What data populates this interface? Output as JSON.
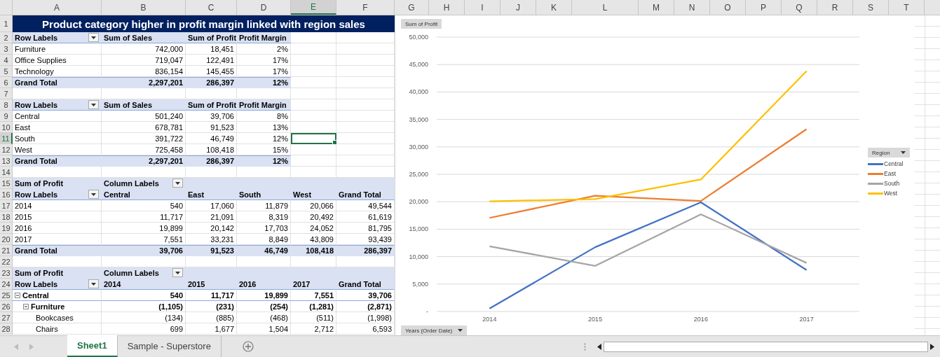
{
  "columns": [
    {
      "label": "A",
      "selected": false
    },
    {
      "label": "B",
      "selected": false
    },
    {
      "label": "C",
      "selected": false
    },
    {
      "label": "D",
      "selected": false
    },
    {
      "label": "E",
      "selected": true
    },
    {
      "label": "F",
      "selected": false
    },
    {
      "label": "G",
      "selected": false
    },
    {
      "label": "H",
      "selected": false
    },
    {
      "label": "I",
      "selected": false
    },
    {
      "label": "J",
      "selected": false
    },
    {
      "label": "K",
      "selected": false
    },
    {
      "label": "L",
      "selected": false
    },
    {
      "label": "M",
      "selected": false
    },
    {
      "label": "N",
      "selected": false
    },
    {
      "label": "O",
      "selected": false
    },
    {
      "label": "P",
      "selected": false
    },
    {
      "label": "Q",
      "selected": false
    },
    {
      "label": "R",
      "selected": false
    },
    {
      "label": "S",
      "selected": false
    },
    {
      "label": "T",
      "selected": false
    }
  ],
  "rows": [
    {
      "number": "1",
      "selected": false,
      "kind": "title",
      "title": "Product category higher in profit margin linked with region sales"
    },
    {
      "number": "2",
      "selected": false,
      "kind": "header",
      "cells": [
        {
          "text": "Row Labels",
          "filter": true
        },
        {
          "text": "Sum of Sales"
        },
        {
          "text": "Sum of Profit"
        },
        {
          "text": "Profit Margin"
        },
        null,
        null
      ]
    },
    {
      "number": "3",
      "selected": false,
      "kind": "data",
      "cells": [
        {
          "text": "Furniture"
        },
        {
          "text": "742,000"
        },
        {
          "text": "18,451"
        },
        {
          "text": "2%"
        },
        null,
        null
      ]
    },
    {
      "number": "4",
      "selected": false,
      "kind": "data",
      "cells": [
        {
          "text": "Office Supplies"
        },
        {
          "text": "719,047"
        },
        {
          "text": "122,491"
        },
        {
          "text": "17%"
        },
        null,
        null
      ]
    },
    {
      "number": "5",
      "selected": false,
      "kind": "data",
      "cells": [
        {
          "text": "Technology"
        },
        {
          "text": "836,154"
        },
        {
          "text": "145,455"
        },
        {
          "text": "17%"
        },
        null,
        null
      ]
    },
    {
      "number": "6",
      "selected": false,
      "kind": "total",
      "cells": [
        {
          "text": "Grand Total"
        },
        {
          "text": "2,297,201"
        },
        {
          "text": "286,397"
        },
        {
          "text": "12%"
        },
        null,
        null
      ]
    },
    {
      "number": "7",
      "selected": false,
      "kind": "blank"
    },
    {
      "number": "8",
      "selected": false,
      "kind": "header",
      "cells": [
        {
          "text": "Row Labels",
          "filter": true
        },
        {
          "text": "Sum of Sales"
        },
        {
          "text": "Sum of Profit"
        },
        {
          "text": "Profit Margin"
        },
        null,
        null
      ]
    },
    {
      "number": "9",
      "selected": false,
      "kind": "data",
      "cells": [
        {
          "text": "Central"
        },
        {
          "text": "501,240"
        },
        {
          "text": "39,706"
        },
        {
          "text": "8%"
        },
        null,
        null
      ]
    },
    {
      "number": "10",
      "selected": false,
      "kind": "data",
      "cells": [
        {
          "text": "East"
        },
        {
          "text": "678,781"
        },
        {
          "text": "91,523"
        },
        {
          "text": "13%"
        },
        null,
        null
      ]
    },
    {
      "number": "11",
      "selected": true,
      "kind": "data",
      "cells": [
        {
          "text": "South"
        },
        {
          "text": "391,722"
        },
        {
          "text": "46,749"
        },
        {
          "text": "12%"
        },
        null,
        null
      ]
    },
    {
      "number": "12",
      "selected": false,
      "kind": "data",
      "cells": [
        {
          "text": "West"
        },
        {
          "text": "725,458"
        },
        {
          "text": "108,418"
        },
        {
          "text": "15%"
        },
        null,
        null
      ]
    },
    {
      "number": "13",
      "selected": false,
      "kind": "total",
      "cells": [
        {
          "text": "Grand Total"
        },
        {
          "text": "2,297,201"
        },
        {
          "text": "286,397"
        },
        {
          "text": "12%"
        },
        null,
        null
      ]
    },
    {
      "number": "14",
      "selected": false,
      "kind": "blank"
    },
    {
      "number": "15",
      "selected": false,
      "kind": "header",
      "cells": [
        {
          "text": "Sum of Profit"
        },
        {
          "text": "Column Labels",
          "filter": true
        },
        {},
        {},
        {},
        {}
      ]
    },
    {
      "number": "16",
      "selected": false,
      "kind": "header",
      "cells": [
        {
          "text": "Row Labels",
          "filter": true
        },
        {
          "text": "Central"
        },
        {
          "text": "East"
        },
        {
          "text": "South"
        },
        {
          "text": "West"
        },
        {
          "text": "Grand Total"
        }
      ]
    },
    {
      "number": "17",
      "selected": false,
      "kind": "data",
      "cells": [
        {
          "text": "2014"
        },
        {
          "text": "540"
        },
        {
          "text": "17,060"
        },
        {
          "text": "11,879"
        },
        {
          "text": "20,066"
        },
        {
          "text": "49,544"
        }
      ]
    },
    {
      "number": "18",
      "selected": false,
      "kind": "data",
      "cells": [
        {
          "text": "2015"
        },
        {
          "text": "11,717"
        },
        {
          "text": "21,091"
        },
        {
          "text": "8,319"
        },
        {
          "text": "20,492"
        },
        {
          "text": "61,619"
        }
      ]
    },
    {
      "number": "19",
      "selected": false,
      "kind": "data",
      "cells": [
        {
          "text": "2016"
        },
        {
          "text": "19,899"
        },
        {
          "text": "20,142"
        },
        {
          "text": "17,703"
        },
        {
          "text": "24,052"
        },
        {
          "text": "81,795"
        }
      ]
    },
    {
      "number": "20",
      "selected": false,
      "kind": "data",
      "cells": [
        {
          "text": "2017"
        },
        {
          "text": "7,551"
        },
        {
          "text": "33,231"
        },
        {
          "text": "8,849"
        },
        {
          "text": "43,809"
        },
        {
          "text": "93,439"
        }
      ]
    },
    {
      "number": "21",
      "selected": false,
      "kind": "total",
      "cells": [
        {
          "text": "Grand Total"
        },
        {
          "text": "39,706"
        },
        {
          "text": "91,523"
        },
        {
          "text": "46,749"
        },
        {
          "text": "108,418"
        },
        {
          "text": "286,397"
        }
      ]
    },
    {
      "number": "22",
      "selected": false,
      "kind": "blank"
    },
    {
      "number": "23",
      "selected": false,
      "kind": "header",
      "cells": [
        {
          "text": "Sum of Profit"
        },
        {
          "text": "Column Labels",
          "filter": true
        },
        {},
        {},
        {},
        {}
      ]
    },
    {
      "number": "24",
      "selected": false,
      "kind": "header",
      "cells": [
        {
          "text": "Row Labels",
          "filter": true
        },
        {
          "text": "2014"
        },
        {
          "text": "2015"
        },
        {
          "text": "2016"
        },
        {
          "text": "2017"
        },
        {
          "text": "Grand Total"
        }
      ]
    },
    {
      "number": "25",
      "selected": false,
      "kind": "group",
      "cells": [
        {
          "text": "Central",
          "expanded": true
        },
        {
          "text": "540"
        },
        {
          "text": "11,717"
        },
        {
          "text": "19,899"
        },
        {
          "text": "7,551"
        },
        {
          "text": "39,706"
        }
      ]
    },
    {
      "number": "26",
      "selected": false,
      "kind": "subgroup",
      "cells": [
        {
          "text": "Furniture",
          "expanded": true
        },
        {
          "text": "(1,105)"
        },
        {
          "text": "(231)"
        },
        {
          "text": "(254)"
        },
        {
          "text": "(1,281)"
        },
        {
          "text": "(2,871)"
        }
      ]
    },
    {
      "number": "27",
      "selected": false,
      "kind": "item",
      "cells": [
        {
          "text": "Bookcases"
        },
        {
          "text": "(134)"
        },
        {
          "text": "(885)"
        },
        {
          "text": "(468)"
        },
        {
          "text": "(511)"
        },
        {
          "text": "(1,998)"
        }
      ]
    },
    {
      "number": "28",
      "selected": false,
      "kind": "item",
      "cells": [
        {
          "text": "Chairs"
        },
        {
          "text": "699"
        },
        {
          "text": "1,677"
        },
        {
          "text": "1,504"
        },
        {
          "text": "2,712"
        },
        {
          "text": "6,593"
        }
      ]
    }
  ],
  "chart": {
    "value_field": "Sum of Profit",
    "legend_field": "Region",
    "axis_field": "Years (Order Date)",
    "chart_data": {
      "type": "line",
      "grid": true,
      "categories": [
        "2014",
        "2015",
        "2016",
        "2017"
      ],
      "series": [
        {
          "name": "Central",
          "color": "#4472c4",
          "values": [
            540,
            11717,
            19899,
            7551
          ]
        },
        {
          "name": "East",
          "color": "#ed7d31",
          "values": [
            17060,
            21091,
            20142,
            33231
          ]
        },
        {
          "name": "South",
          "color": "#a5a5a5",
          "values": [
            11879,
            8319,
            17703,
            8849
          ]
        },
        {
          "name": "West",
          "color": "#ffc000",
          "values": [
            20066,
            20492,
            24052,
            43809
          ]
        }
      ],
      "ylim": [
        0,
        50000
      ],
      "yticks": [
        {
          "value": 0,
          "label": "-"
        },
        {
          "value": 5000,
          "label": "5,000"
        },
        {
          "value": 10000,
          "label": "10,000"
        },
        {
          "value": 15000,
          "label": "15,000"
        },
        {
          "value": 20000,
          "label": "20,000"
        },
        {
          "value": 25000,
          "label": "25,000"
        },
        {
          "value": 30000,
          "label": "30,000"
        },
        {
          "value": 35000,
          "label": "35,000"
        },
        {
          "value": 40000,
          "label": "40,000"
        },
        {
          "value": 45000,
          "label": "45,000"
        },
        {
          "value": 50000,
          "label": "50,000"
        }
      ]
    }
  },
  "sheet_tabs": [
    {
      "label": "Sheet1",
      "selected": true
    },
    {
      "label": "Sample - Superstore",
      "selected": false
    }
  ]
}
